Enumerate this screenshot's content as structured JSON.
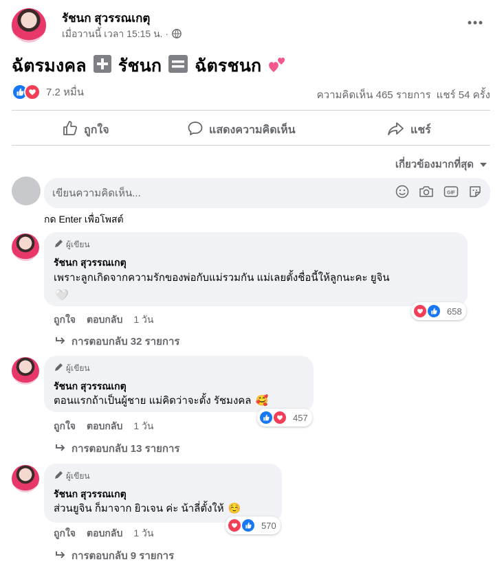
{
  "post": {
    "author": "รัชนก สุวรรณเกตุ",
    "time": "เมื่อวานนี้ เวลา 15:15 น. ·",
    "privacy_icon": "globe-icon",
    "more_icon": "more-horizontal-icon",
    "text_part1": "ฉัตรมงคล",
    "text_part2": "รัชนก",
    "text_part3": "ฉัตรชนก",
    "plus_emoji": "➕",
    "equals_emoji": "🟰",
    "hearts_emoji": "💕"
  },
  "stats": {
    "reactions_count": "7.2 หมื่น",
    "comments": "ความคิดเห็น 465 รายการ",
    "shares": "แชร์ 54 ครั้ง"
  },
  "actions": {
    "like": "ถูกใจ",
    "comment": "แสดงความคิดเห็น",
    "share": "แชร์"
  },
  "sort": {
    "label": "เกี่ยวข้องมากที่สุด"
  },
  "composer": {
    "placeholder": "เขียนความคิดเห็น...",
    "hint": "กด Enter เพื่อโพสต์"
  },
  "comments": [
    {
      "author_tag": "ผู้เขียน",
      "name": "รัชนก สุวรรณเกตุ",
      "text": "เพราะลูกเกิดจากความรักของพ่อกับแม่รวมกัน แม่เลยตั้งชื่อนี้ให้ลูกนะคะ ยูจิน",
      "emoji": "🤍",
      "like": "ถูกใจ",
      "reply": "ตอบกลับ",
      "time": "1 วัน",
      "reactions": "658",
      "replies": "การตอบกลับ 32 รายการ"
    },
    {
      "author_tag": "ผู้เขียน",
      "name": "รัชนก สุวรรณเกตุ",
      "text": "ตอนแรกถ้าเป็นผู้ชาย แม่คิดว่าจะตั้ง รัชมงคล",
      "emoji": "🥰",
      "like": "ถูกใจ",
      "reply": "ตอบกลับ",
      "time": "1 วัน",
      "reactions": "457",
      "replies": "การตอบกลับ 13 รายการ"
    },
    {
      "author_tag": "ผู้เขียน",
      "name": "รัชนก สุวรรณเกตุ",
      "text": "ส่วนยูจิน ก็มาจาก ยิวเจน ค่ะ น้าลี่ตั้งให้",
      "emoji": "☺️",
      "like": "ถูกใจ",
      "reply": "ตอบกลับ",
      "time": "1 วัน",
      "reactions": "570",
      "replies": "การตอบกลับ 9 รายการ"
    }
  ],
  "colors": {
    "like": "#1877f2",
    "love": "#f33e58",
    "secondary_text": "#65676b",
    "bubble": "#f0f2f5"
  }
}
